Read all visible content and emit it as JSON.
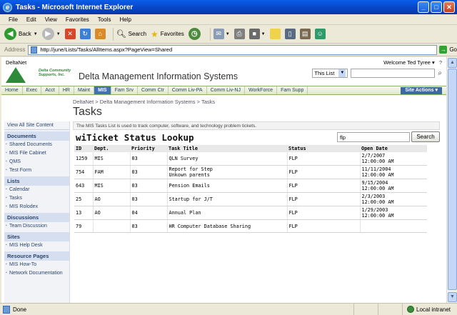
{
  "window": {
    "title": "Tasks - Microsoft Internet Explorer",
    "controls": [
      "_",
      "□",
      "✕"
    ]
  },
  "menu": [
    "File",
    "Edit",
    "View",
    "Favorites",
    "Tools",
    "Help"
  ],
  "toolbar": {
    "back": "Back",
    "search": "Search",
    "favorites": "Favorites"
  },
  "address": {
    "label": "Address",
    "url": "http://june/Lists/Tasks/AllItems.aspx?PageView=Shared",
    "go": "Go"
  },
  "site": {
    "portal": "DeltaNet",
    "welcome": "Welcome Ted Tyree ▾",
    "logo_text": "Delta Community Supports, Inc.",
    "title": "Delta Management Information Systems",
    "search_scope": "This List",
    "search_value": ""
  },
  "nav": {
    "items": [
      "Home",
      "Exec",
      "Acct",
      "HR",
      "Maint",
      "MIS",
      "Fam Srv",
      "Comm Ctr",
      "Comm Liv-PA",
      "Comm Liv-NJ",
      "WorkForce",
      "Fam Supp"
    ],
    "active": "MIS",
    "site_actions": "Site Actions ▾"
  },
  "breadcrumb": "DeltaNet > Delta Management Information Systems > Tasks",
  "page_title": "Tasks",
  "description": "The MIS Tasks List is used to track computer, software, and technology problem tickets.",
  "leftnav": {
    "view_all": "View All Site Content",
    "sections": [
      {
        "heading": "Documents",
        "items": [
          "Shared Documents",
          "MIS File Cabinet",
          "QMS",
          "Test Form"
        ]
      },
      {
        "heading": "Lists",
        "items": [
          "Calendar",
          "Tasks",
          "MIS Rolodex"
        ]
      },
      {
        "heading": "Discussions",
        "items": [
          "Team Discussion"
        ]
      },
      {
        "heading": "Sites",
        "items": [
          "MIS Help Desk"
        ]
      },
      {
        "heading": "Resource Pages",
        "items": [
          "MIS How-To",
          "Network Documentation"
        ]
      }
    ]
  },
  "webpart": {
    "title": "wiTicket Status Lookup",
    "search_value": "flp",
    "search_button": "Search",
    "columns": [
      "ID",
      "Dept.",
      "Priority",
      "Task Title",
      "Status",
      "Open Date"
    ],
    "rows": [
      [
        "1259",
        "MIS",
        "03",
        "QLN Survey",
        "FLP",
        "2/7/2007\n12:00:00 AM"
      ],
      [
        "754",
        "FAM",
        "03",
        "Report for Step\nUnkown parents",
        "FLP",
        "11/11/2004\n12:00:00 AM"
      ],
      [
        "643",
        "MIS",
        "03",
        "Pension Emails",
        "FLP",
        "9/15/2004\n12:00:00 AM"
      ],
      [
        "25",
        "AO",
        "03",
        "Startup for J/T",
        "FLP",
        "2/3/2003\n12:00:00 AM"
      ],
      [
        "13",
        "AO",
        "04",
        "Annual Plan",
        "FLP",
        "1/29/2003\n12:00:00 AM"
      ],
      [
        "79",
        "",
        "03",
        "HR Computer Database Sharing",
        "FLP",
        ""
      ]
    ]
  },
  "status": {
    "left": "Done",
    "zone": "Local intranet"
  }
}
